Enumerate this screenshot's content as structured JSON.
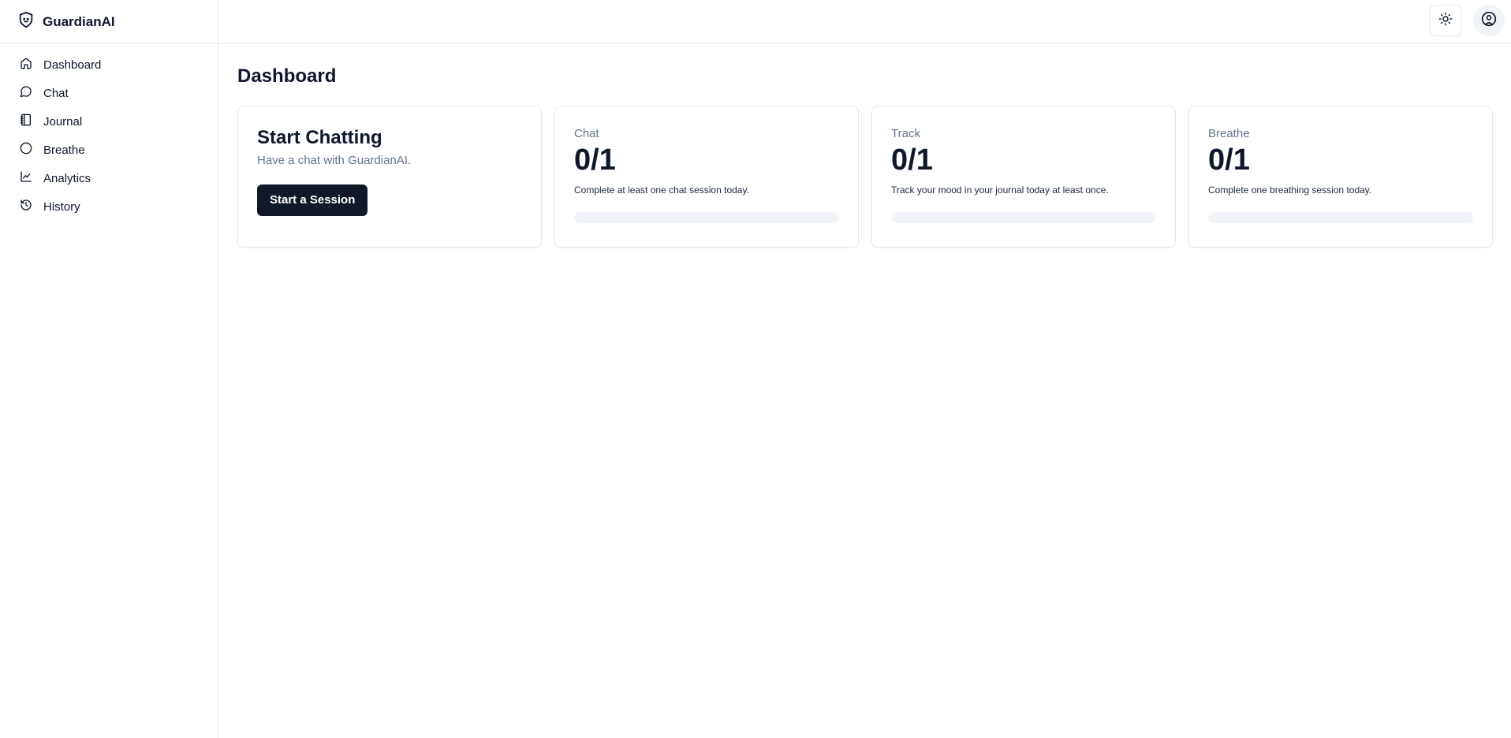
{
  "app": {
    "name": "GuardianAI"
  },
  "sidebar": {
    "items": [
      {
        "label": "Dashboard",
        "icon": "home-icon"
      },
      {
        "label": "Chat",
        "icon": "message-circle-icon"
      },
      {
        "label": "Journal",
        "icon": "notebook-icon"
      },
      {
        "label": "Breathe",
        "icon": "circle-icon"
      },
      {
        "label": "Analytics",
        "icon": "line-chart-icon"
      },
      {
        "label": "History",
        "icon": "history-icon"
      }
    ]
  },
  "header": {
    "theme_icon": "sun-icon",
    "account_icon": "user-circle-icon"
  },
  "main": {
    "title": "Dashboard",
    "hero": {
      "title": "Start Chatting",
      "subtitle": "Have a chat with GuardianAI.",
      "button": "Start a Session"
    },
    "stats": [
      {
        "label": "Chat",
        "value": "0/1",
        "description": "Complete at least one chat session today.",
        "progress": 0
      },
      {
        "label": "Track",
        "value": "0/1",
        "description": "Track your mood in your journal today at least once.",
        "progress": 0
      },
      {
        "label": "Breathe",
        "value": "0/1",
        "description": "Complete one breathing session today.",
        "progress": 0
      }
    ]
  },
  "colors": {
    "primary": "#111827",
    "muted_text": "#64748b",
    "border": "#e5e7eb",
    "track": "#f1f5f9"
  }
}
